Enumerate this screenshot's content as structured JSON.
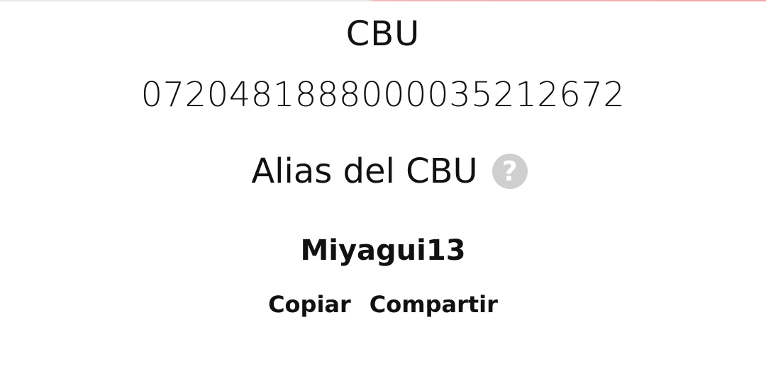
{
  "cbu": {
    "label": "CBU",
    "number": "0720481888000035212672"
  },
  "alias": {
    "label": "Alias del CBU",
    "help_icon": "question-circle-icon",
    "help_glyph": "?",
    "value": "Miyagui13"
  },
  "actions": {
    "copy_label": "Copiar",
    "share_label": "Compartir"
  },
  "colors": {
    "text": "#111111",
    "help_icon_bg": "#cfcfcf",
    "accent_line": "#f2a8a8"
  }
}
